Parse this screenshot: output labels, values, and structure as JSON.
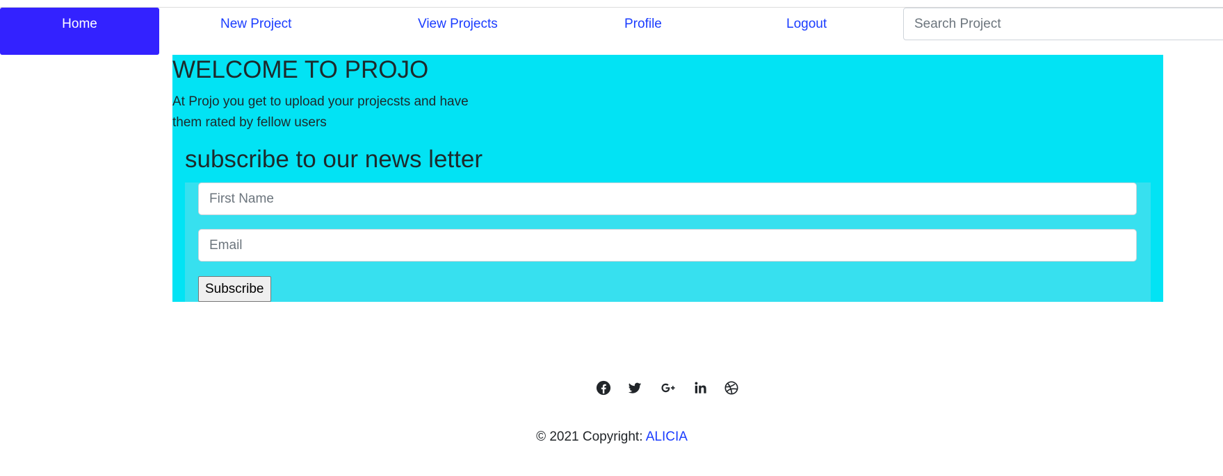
{
  "nav": {
    "home": "Home",
    "new_project": "New Project",
    "view_projects": "View Projects",
    "profile": "Profile",
    "logout": "Logout",
    "search_placeholder": "Search Project"
  },
  "hero": {
    "title": "WELCOME TO PROJO",
    "text": "At Projo you get to upload your projecsts and have them rated by fellow users"
  },
  "newsletter": {
    "title": "subscribe to our news letter",
    "first_name_placeholder": "First Name",
    "email_placeholder": "Email",
    "button": "Subscribe"
  },
  "social": [
    "facebook-icon",
    "twitter-icon",
    "google-plus-icon",
    "linkedin-icon",
    "dribbble-icon"
  ],
  "footer": {
    "copyright": "© 2021 Copyright: ",
    "author": "ALICIA"
  },
  "colors": {
    "nav_active": "#3322ff",
    "link": "#1a3cff",
    "hero_bg": "#02e3f4",
    "form_bg": "#37e0ef"
  }
}
